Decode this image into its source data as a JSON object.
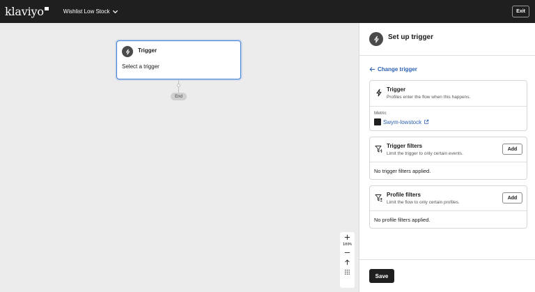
{
  "topbar": {
    "logo": "klaviyo",
    "flow_name": "Wishlist Low Stock",
    "exit_label": "Exit"
  },
  "canvas": {
    "trigger_node": {
      "title": "Trigger",
      "subtitle": "Select a trigger"
    },
    "end_label": "End",
    "zoom": {
      "level": "100%"
    }
  },
  "panel": {
    "title": "Set up trigger",
    "change_trigger_label": "Change trigger",
    "trigger_card": {
      "title": "Trigger",
      "description": "Profiles enter the flow when this happens.",
      "metric_label": "Metric",
      "metric_value": "Swym-lowstock"
    },
    "trigger_filters": {
      "title": "Trigger filters",
      "description": "Limit the trigger to only certain events.",
      "add_label": "Add",
      "empty_text": "No trigger filters applied."
    },
    "profile_filters": {
      "title": "Profile filters",
      "description": "Limit the flow to only certain profiles.",
      "add_label": "Add",
      "empty_text": "No profile filters applied."
    },
    "save_label": "Save"
  },
  "colors": {
    "topbar_bg": "#1f1f1f",
    "accent_link": "#2a5fb3",
    "node_border": "#3a7bd5",
    "canvas_bg": "#ececec"
  },
  "icons": [
    "chevron-down-icon",
    "lightning-icon",
    "arrow-left-icon",
    "external-link-icon",
    "filter-lightning-icon",
    "filter-person-icon",
    "plus-icon",
    "minus-icon",
    "arrow-up-icon",
    "grid-icon"
  ]
}
